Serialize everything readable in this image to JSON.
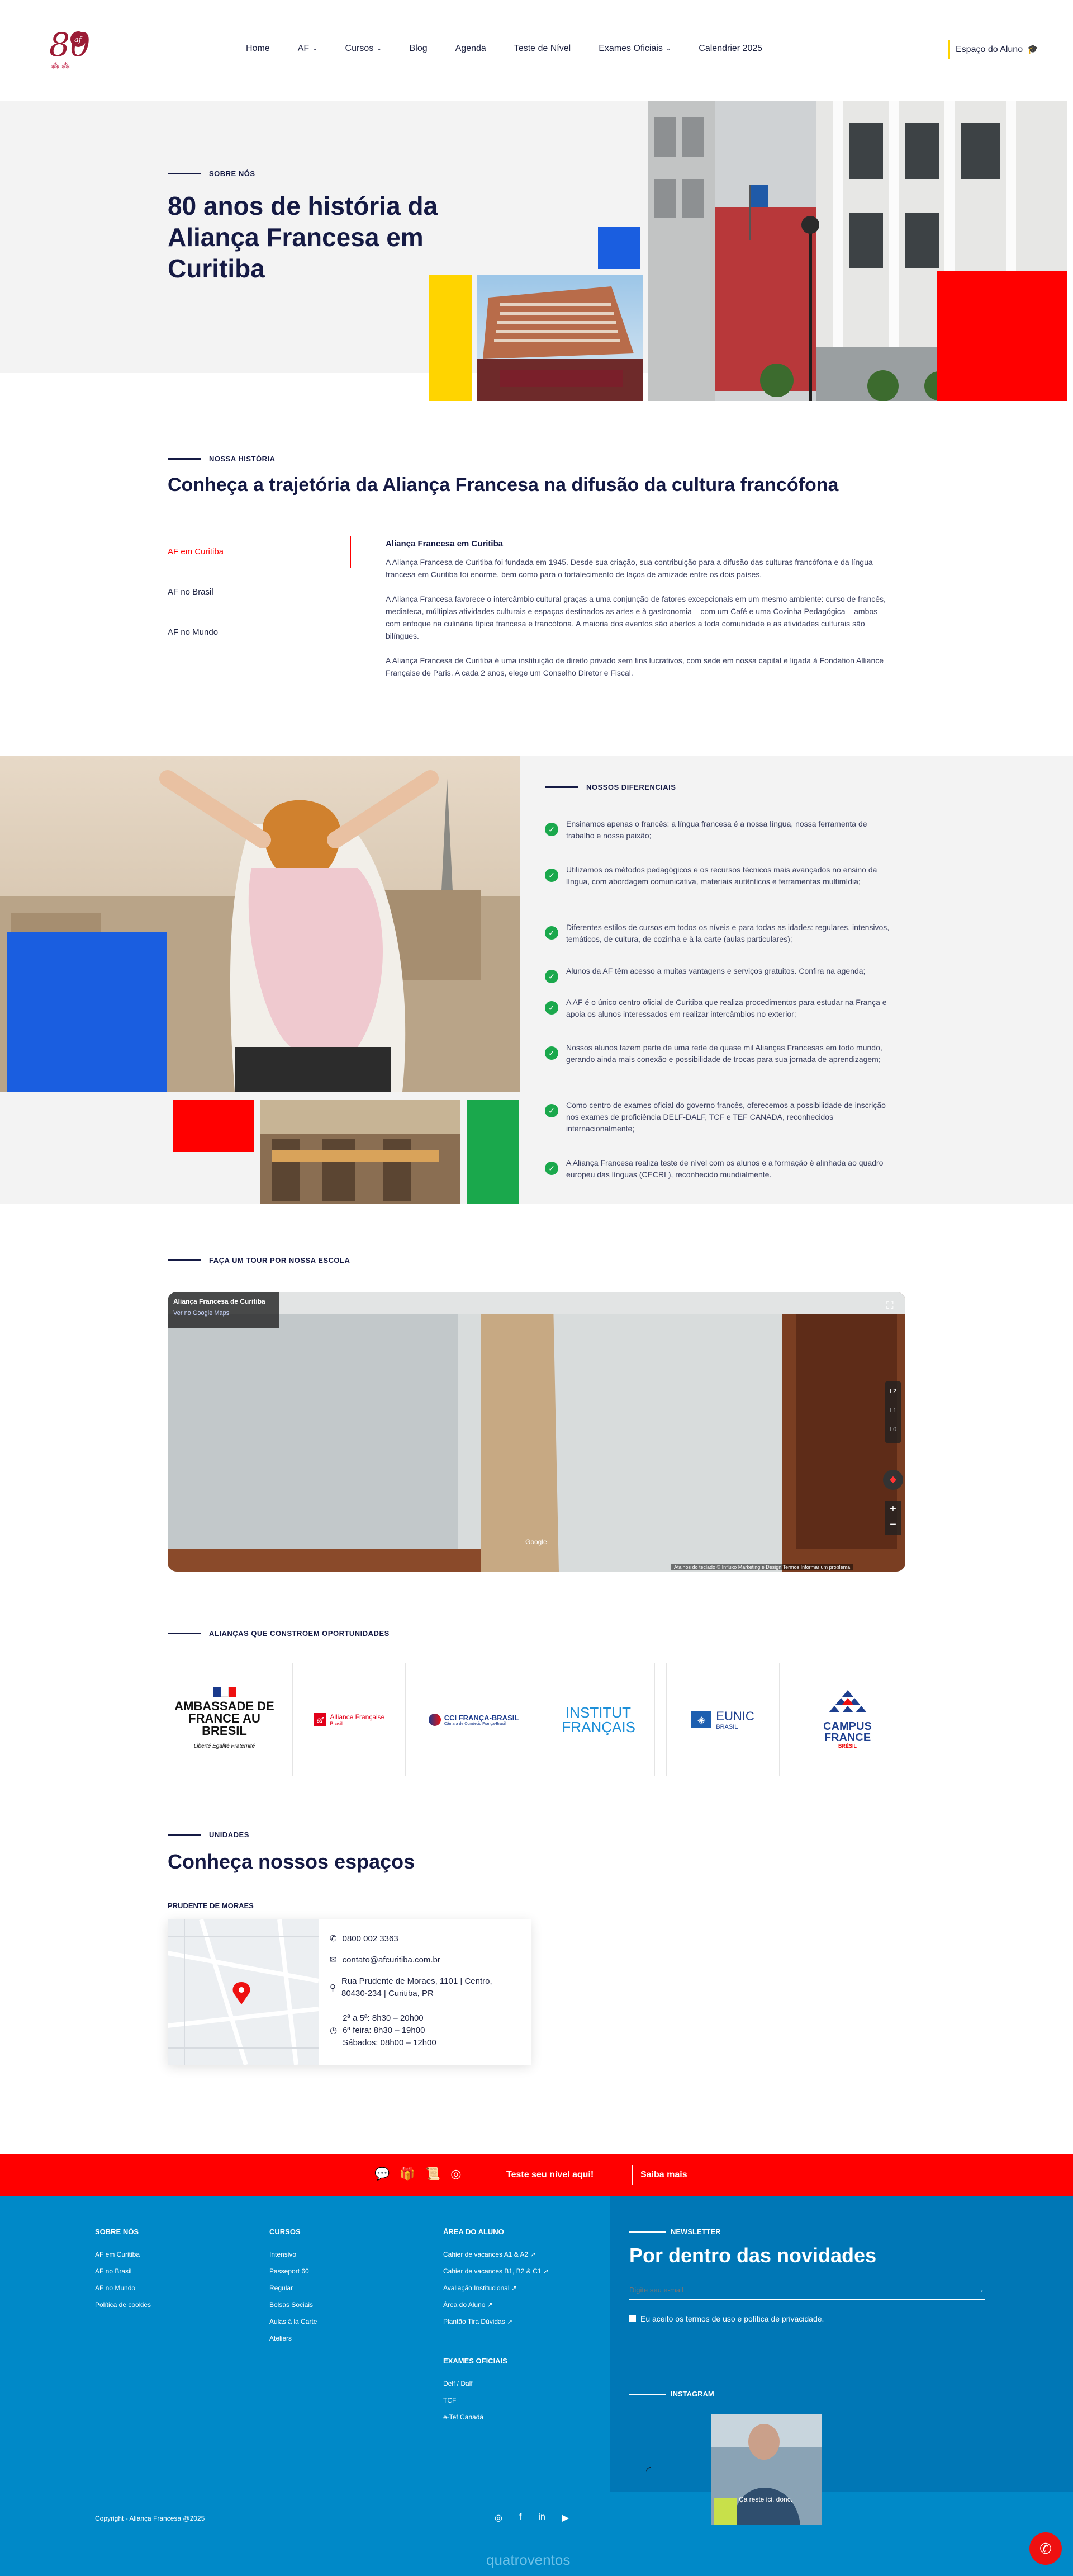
{
  "header": {
    "logo_text": "80",
    "logo_sub": "af",
    "nav": [
      {
        "label": "Home",
        "dropdown": false
      },
      {
        "label": "AF",
        "dropdown": true
      },
      {
        "label": "Cursos",
        "dropdown": true
      },
      {
        "label": "Blog",
        "dropdown": false
      },
      {
        "label": "Agenda",
        "dropdown": false
      },
      {
        "label": "Teste de Nível",
        "dropdown": false
      },
      {
        "label": "Exames Oficiais",
        "dropdown": true
      },
      {
        "label": "Calendrier 2025",
        "dropdown": false
      }
    ],
    "student_area": "Espaço do Aluno"
  },
  "hero": {
    "eyebrow": "SOBRE NÓS",
    "title": "80 anos de história da Aliança Francesa em Curitiba"
  },
  "history": {
    "eyebrow": "NOSSA HISTÓRIA",
    "title": "Conheça a trajetória da Aliança Francesa na difusão da cultura francófona",
    "tabs": [
      "AF em Curitiba",
      "AF no Brasil",
      "AF no Mundo"
    ],
    "active_tab": "AF em Curitiba",
    "content_title": "Aliança Francesa em Curitiba",
    "paragraphs": [
      "A Aliança Francesa de Curitiba foi fundada em 1945. Desde sua criação, sua contribuição para a difusão das culturas francófona e da língua francesa em Curitiba foi enorme, bem como para o fortalecimento de laços de amizade entre os dois países.",
      "A Aliança Francesa favorece o intercâmbio cultural graças a uma conjunção de fatores excepcionais em um mesmo ambiente: curso de francês, mediateca, múltiplas atividades culturais e espaços destinados as artes e à gastronomia – com um Café e uma Cozinha Pedagógica – ambos com enfoque na culinária típica francesa e francófona. A maioria dos eventos são abertos a toda comunidade e as atividades culturais são bilíngues.",
      "A Aliança Francesa de Curitiba é uma instituição de direito privado sem fins lucrativos, com sede em nossa capital e ligada à Fondation Alliance Française de Paris. A cada 2 anos, elege um Conselho Diretor e Fiscal."
    ]
  },
  "differentials": {
    "eyebrow": "NOSSOS DIFERENCIAIS",
    "items": [
      "Ensinamos apenas o francês: a língua francesa é a nossa língua, nossa ferramenta de trabalho e nossa paixão;",
      "Utilizamos os métodos pedagógicos e os recursos técnicos mais avançados no ensino da língua, com abordagem comunicativa, materiais autênticos e ferramentas multimídia;",
      "Diferentes estilos de cursos em todos os níveis e para todas as idades: regulares, intensivos, temáticos, de cultura, de cozinha e à la carte (aulas particulares);",
      "Alunos da AF têm acesso a muitas vantagens e serviços gratuitos. Confira na agenda;",
      "A AF é o único centro oficial de Curitiba que realiza procedimentos para estudar na França e apoia os alunos interessados em realizar intercâmbios no exterior;",
      "Nossos alunos fazem parte de uma rede de quase mil Alianças Francesas em todo mundo, gerando ainda mais conexão e possibilidade de trocas para sua jornada de aprendizagem;",
      "Como centro de exames oficial do governo francês, oferecemos a possibilidade de inscrição nos exames de proficiência DELF-DALF, TCF e TEF CANADA, reconhecidos internacionalmente;",
      "A Aliança Francesa realiza teste de nível com os alunos e a formação é alinhada ao quadro europeu das línguas (CECRL), reconhecido mundialmente."
    ]
  },
  "tour": {
    "eyebrow": "FAÇA UM TOUR POR NOSSA ESCOLA",
    "place_name": "Aliança Francesa de Curitiba",
    "maps_link": "Ver no Google Maps",
    "floors": [
      "L2",
      "L1",
      "L0"
    ],
    "google": "Google",
    "attribution": "Atalhos do teclado   © Influxo Marketing e Design   Termos   Informar um problema"
  },
  "partners": {
    "eyebrow": "ALIANÇAS QUE CONSTROEM OPORTUNIDADES",
    "logos": [
      {
        "name": "AMBASSADE DE FRANCE AU BRESIL",
        "sub": "Liberté Égalité Fraternité"
      },
      {
        "name": "Alliance Française",
        "sub": "Brasil"
      },
      {
        "name": "CCI FRANÇA-BRASIL",
        "sub": "Câmara de Comércio França-Brasil"
      },
      {
        "name": "INSTITUT FRANÇAIS",
        "sub": ""
      },
      {
        "name": "EUNIC",
        "sub": "BRASIL"
      },
      {
        "name": "CAMPUS FRANCE",
        "sub": "BRÉSIL"
      }
    ]
  },
  "units": {
    "eyebrow": "UNIDADES",
    "title": "Conheça nossos espaços",
    "unit_name": "PRUDENTE DE MORAES",
    "phone": "0800 002 3363",
    "email": "contato@afcuritiba.com.br",
    "address_1": "Rua Prudente de Moraes, 1101 | Centro,",
    "address_2": "80430-234 | Curitiba, PR",
    "hours": [
      "2ª a 5ª: 8h30 – 20h00",
      "6ª feira: 8h30 – 19h00",
      "Sábados: 08h00 – 12h00"
    ]
  },
  "redbar": {
    "cta": "Teste seu nível aqui!",
    "more": "Saiba mais"
  },
  "footer": {
    "col1_title": "SOBRE NÓS",
    "col1": [
      "AF em Curitiba",
      "AF no Brasil",
      "AF no Mundo",
      "Política de cookies"
    ],
    "col2_title": "CURSOS",
    "col2": [
      "Intensivo",
      "Passeport 60",
      "Regular",
      "Bolsas Sociais",
      "Aulas à la Carte",
      "Ateliers"
    ],
    "col3_title": "ÁREA DO ALUNO",
    "col3": [
      "Cahier de vacances A1 & A2",
      "Cahier de vacances B1, B2 & C1",
      "Avaliação Institucional",
      "Área do Aluno",
      "Plantão Tira Dúvidas"
    ],
    "col4_title": "EXAMES OFICIAIS",
    "col4": [
      "Delf / Dalf",
      "TCF",
      "e-Tef Canadá"
    ],
    "newsletter_eyebrow": "NEWSLETTER",
    "newsletter_title": "Por dentro das novidades",
    "email_placeholder": "Digite seu e-mail",
    "terms": "Eu aceito os termos de uso e política de privacidade.",
    "instagram_eyebrow": "INSTAGRAM",
    "insta_caption": "Ça reste ici, donc.",
    "copyright": "Copyright - Aliança Francesa @2025",
    "credit": "quatroventos"
  },
  "colors": {
    "navy": "#151a44",
    "red": "#ff0000",
    "blue": "#1a5ee0",
    "yellow": "#ffd400",
    "green": "#1aa84c",
    "footer_blue": "#0089c8"
  }
}
